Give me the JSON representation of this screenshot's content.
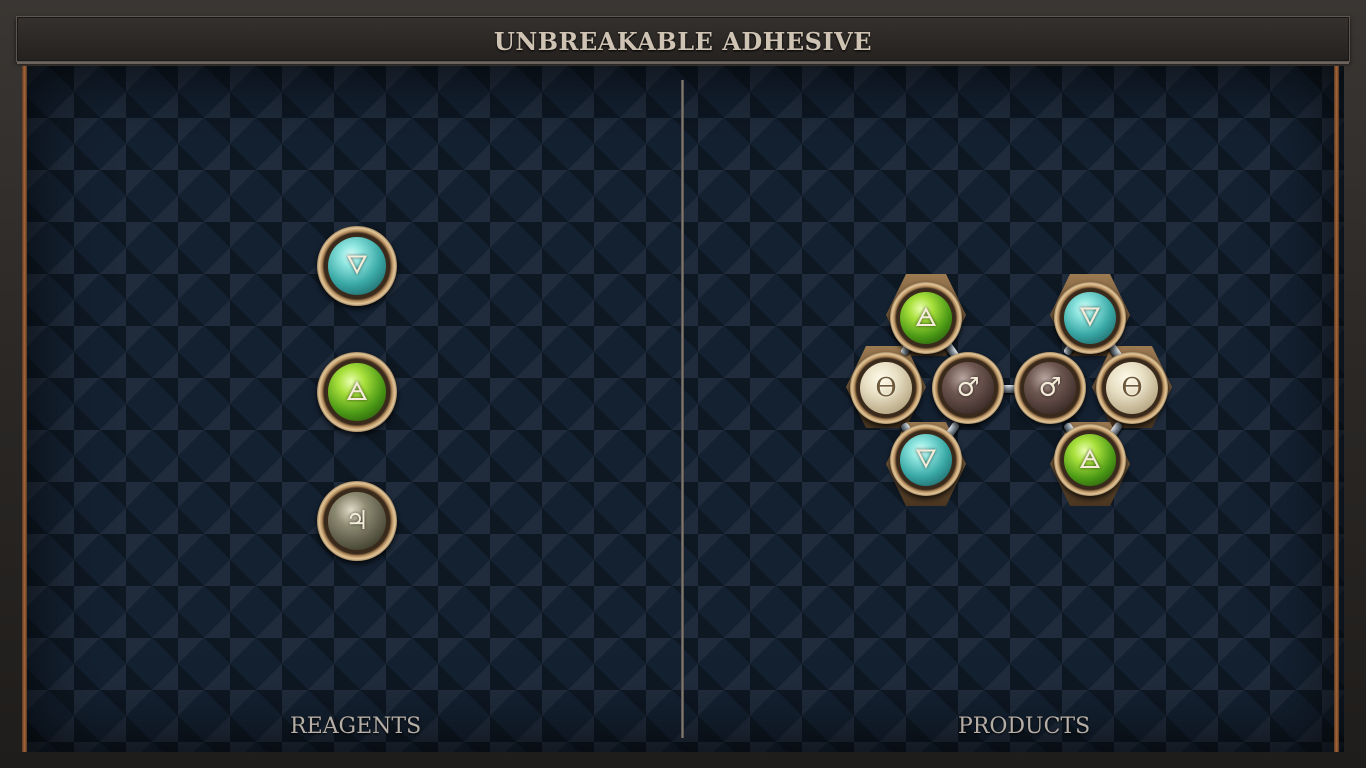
{
  "title": "UNBREAKABLE ADHESIVE",
  "reagents_label": "REAGENTS",
  "products_label": "PRODUCTS",
  "symbols": {
    "water": "🜄",
    "air": "🜁",
    "salt": "ϴ",
    "iron": "♂",
    "stone": "♃"
  },
  "reagents": [
    "water",
    "air",
    "stone"
  ],
  "products": [
    "air",
    "salt",
    "iron",
    "water",
    "water",
    "iron",
    "salt",
    "air"
  ],
  "colors": {
    "frame": "#2b2826",
    "board": "#142131",
    "title_text": "#cfc3b3",
    "edge_copper": "#a7653a"
  }
}
